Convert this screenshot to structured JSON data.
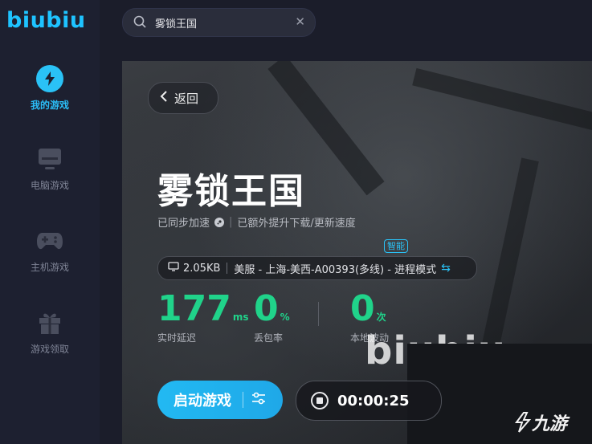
{
  "app": {
    "logo": "biubiu"
  },
  "sidebar": {
    "items": [
      {
        "label": "我的游戏",
        "icon": "lightning-icon",
        "active": true
      },
      {
        "label": "电脑游戏",
        "icon": "monitor-icon",
        "active": false
      },
      {
        "label": "主机游戏",
        "icon": "gamepad-icon",
        "active": false
      },
      {
        "label": "游戏领取",
        "icon": "gift-icon",
        "active": false
      }
    ]
  },
  "search": {
    "value": "雾锁王国",
    "placeholder": "",
    "clear_icon": "close-icon"
  },
  "game": {
    "back_label": "返回",
    "title": "雾锁王国",
    "sync_status": "已同步加速",
    "extra_speed": "已额外提升下载/更新速度",
    "smart_badge": "智能",
    "server": {
      "traffic": "2.05KB",
      "route": "美服 - 上海-美西-A00393(多线) - 进程模式"
    },
    "stats": [
      {
        "value": "177",
        "unit": "ms",
        "label": "实时延迟"
      },
      {
        "value": "0",
        "unit": "%",
        "label": "丢包率"
      },
      {
        "value": "0",
        "unit": "次",
        "label": "本地波动"
      }
    ],
    "start_label": "启动游戏",
    "timer": "00:00:25",
    "watermark": "biubiu"
  },
  "brand_watermark": "九游",
  "colors": {
    "accent": "#2ac2f6",
    "stat_green": "#20d38a",
    "sidebar_bg": "#1d2030"
  }
}
